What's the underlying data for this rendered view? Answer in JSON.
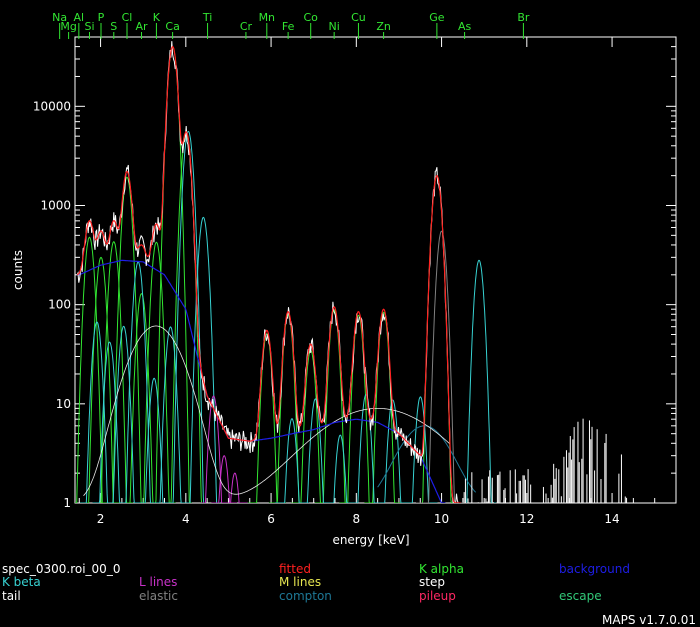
{
  "chart_data": {
    "type": "line",
    "xlabel": "energy [keV]",
    "ylabel": "counts",
    "yscale": "log",
    "xlim": [
      1.4,
      15.5
    ],
    "ylim": [
      1,
      50000
    ],
    "x_ticks": [
      2,
      4,
      6,
      8,
      10,
      12,
      14
    ],
    "y_ticks": [
      1,
      10,
      100,
      1000,
      10000
    ],
    "grid": false,
    "legend_position": "bottom",
    "element_markers": [
      {
        "label": "Na",
        "x": 1.04
      },
      {
        "label": "Mg",
        "x": 1.25
      },
      {
        "label": "Al",
        "x": 1.49
      },
      {
        "label": "Si",
        "x": 1.74
      },
      {
        "label": "P",
        "x": 2.01
      },
      {
        "label": "S",
        "x": 2.31
      },
      {
        "label": "Cl",
        "x": 2.62
      },
      {
        "label": "Ar",
        "x": 2.96
      },
      {
        "label": "K",
        "x": 3.31
      },
      {
        "label": "Ca",
        "x": 3.69
      },
      {
        "label": "Ti",
        "x": 4.51
      },
      {
        "label": "Cr",
        "x": 5.41
      },
      {
        "label": "Mn",
        "x": 5.9
      },
      {
        "label": "Fe",
        "x": 6.4
      },
      {
        "label": "Co",
        "x": 6.93
      },
      {
        "label": "Ni",
        "x": 7.48
      },
      {
        "label": "Cu",
        "x": 8.05
      },
      {
        "label": "Zn",
        "x": 8.64
      },
      {
        "label": "Ge",
        "x": 9.89
      },
      {
        "label": "As",
        "x": 10.54
      },
      {
        "label": "Br",
        "x": 11.92
      }
    ],
    "peaks": [
      {
        "x": 1.74,
        "y": 700
      },
      {
        "x": 2.01,
        "y": 550
      },
      {
        "x": 2.31,
        "y": 700
      },
      {
        "x": 2.62,
        "y": 2200
      },
      {
        "x": 2.96,
        "y": 400
      },
      {
        "x": 3.31,
        "y": 650
      },
      {
        "x": 3.69,
        "y": 40000
      },
      {
        "x": 4.01,
        "y": 5500
      },
      {
        "x": 5.9,
        "y": 55
      },
      {
        "x": 6.4,
        "y": 85
      },
      {
        "x": 6.93,
        "y": 40
      },
      {
        "x": 7.48,
        "y": 95
      },
      {
        "x": 8.05,
        "y": 85
      },
      {
        "x": 8.64,
        "y": 90
      },
      {
        "x": 9.89,
        "y": 2000
      }
    ],
    "series": [
      {
        "name": "fitted",
        "color": "#ff2020"
      },
      {
        "name": "K alpha",
        "color": "#32e632"
      },
      {
        "name": "background",
        "color": "#1e1ee6",
        "x": [
          1.5,
          2.0,
          2.5,
          3.0,
          3.5,
          4.0,
          4.5,
          5.0,
          5.5,
          6.0,
          6.5,
          7.0,
          7.5,
          8.0,
          8.5,
          9.0,
          9.5,
          10.0
        ],
        "y": [
          200,
          250,
          280,
          270,
          200,
          90,
          12,
          4.5,
          4.2,
          4.5,
          5,
          5.5,
          6.5,
          7,
          6.5,
          5,
          3,
          1
        ]
      },
      {
        "name": "K beta",
        "color": "#37d2d2"
      },
      {
        "name": "L lines",
        "color": "#c832c8"
      },
      {
        "name": "M lines",
        "color": "#e6e650"
      },
      {
        "name": "step",
        "color": "#ffffff"
      },
      {
        "name": "tail",
        "color": "#ffffff"
      },
      {
        "name": "elastic",
        "color": "#808080"
      },
      {
        "name": "compton",
        "color": "#1e7896"
      },
      {
        "name": "pileup",
        "color": "#ff2864"
      },
      {
        "name": "escape",
        "color": "#32c878"
      }
    ]
  },
  "legend": {
    "filename": "spec_0300.roi_00_0",
    "items": [
      {
        "label": "fitted",
        "color": "#ff2020"
      },
      {
        "label": "K alpha",
        "color": "#32e632"
      },
      {
        "label": "background",
        "color": "#1e1ee6"
      },
      {
        "label": "K beta",
        "color": "#37d2d2"
      },
      {
        "label": "L lines",
        "color": "#c832c8"
      },
      {
        "label": "M lines",
        "color": "#e6e650"
      },
      {
        "label": "step",
        "color": "#ffffff"
      },
      {
        "label": "tail",
        "color": "#ffffff"
      },
      {
        "label": "elastic",
        "color": "#808080"
      },
      {
        "label": "compton",
        "color": "#1e7896"
      },
      {
        "label": "pileup",
        "color": "#ff2864"
      },
      {
        "label": "escape",
        "color": "#32c878"
      }
    ]
  },
  "version": "MAPS v1.7.0.01"
}
